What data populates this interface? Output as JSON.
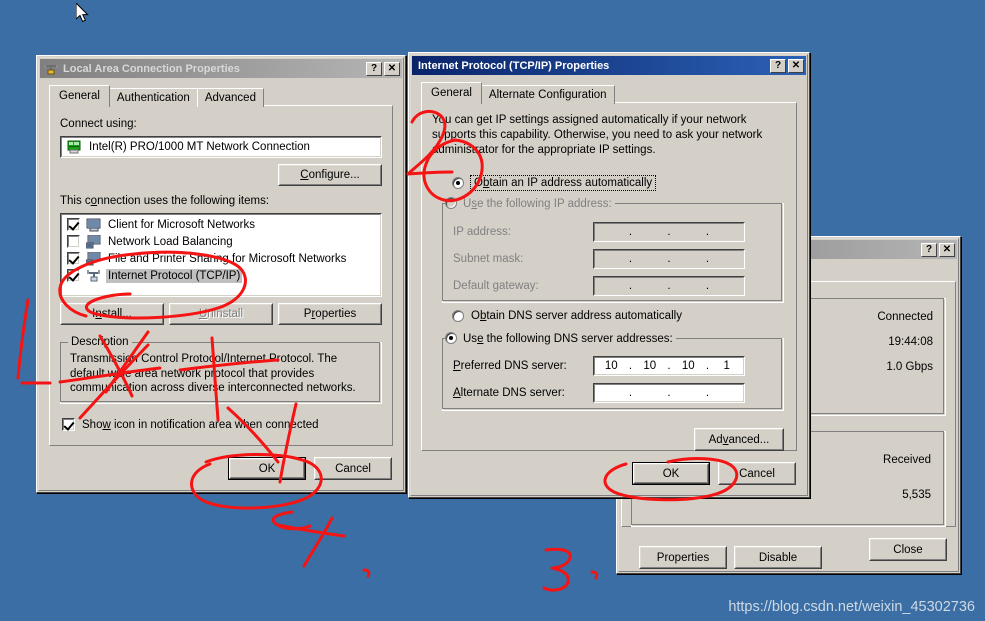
{
  "desktop": {
    "background_color": "#3a6ea5",
    "watermark": "https://blog.csdn.net/weixin_45302736",
    "cursor_icon": "mouse-pointer-icon"
  },
  "lac_dialog": {
    "title": "Local Area Connection Properties",
    "title_icon": "network-connection-icon",
    "help_button": "?",
    "close_button": "✕",
    "tabs": [
      {
        "label": "General",
        "selected": true
      },
      {
        "label": "Authentication",
        "selected": false
      },
      {
        "label": "Advanced",
        "selected": false
      }
    ],
    "connect_using_label": "Connect using:",
    "adapter_name": "Intel(R) PRO/1000 MT Network Connection",
    "adapter_icon": "network-adapter-icon",
    "configure_button": "Configure...",
    "items_label": "This connection uses the following items:",
    "items": [
      {
        "label": "Client for Microsoft Networks",
        "checked": true,
        "selected": false,
        "icon": "client-service-icon"
      },
      {
        "label": "Network Load Balancing",
        "checked": false,
        "selected": false,
        "icon": "service-icon"
      },
      {
        "label": "File and Printer Sharing for Microsoft Networks",
        "checked": true,
        "selected": false,
        "icon": "service-icon"
      },
      {
        "label": "Internet Protocol (TCP/IP)",
        "checked": true,
        "selected": true,
        "icon": "protocol-icon"
      }
    ],
    "install_button": "Install...",
    "uninstall_button": "Uninstall",
    "uninstall_disabled": true,
    "properties_button": "Properties",
    "description_group": "Description",
    "description_text": "Transmission Control Protocol/Internet Protocol. The default wide area network protocol that provides communication across diverse interconnected networks.",
    "show_icon_checkbox": {
      "label": "Show icon in notification area when connected",
      "checked": true
    },
    "ok_button": "OK",
    "cancel_button": "Cancel"
  },
  "tcpip_dialog": {
    "title": "Internet Protocol (TCP/IP) Properties",
    "help_button": "?",
    "close_button": "✕",
    "tabs": [
      {
        "label": "General",
        "selected": true
      },
      {
        "label": "Alternate Configuration",
        "selected": false
      }
    ],
    "intro_text": "You can get IP settings assigned automatically if your network supports this capability. Otherwise, you need to ask your network administrator for the appropriate IP settings.",
    "ip_auto_radio": {
      "label": "Obtain an IP address automatically",
      "selected": true,
      "focused": true
    },
    "ip_manual_radio": {
      "label": "Use the following IP address:",
      "selected": false,
      "disabled": true
    },
    "ip_address_label": "IP address:",
    "ip_address_value": [
      "",
      "",
      "",
      ""
    ],
    "subnet_mask_label": "Subnet mask:",
    "subnet_mask_value": [
      "",
      "",
      "",
      ""
    ],
    "default_gateway_label": "Default gateway:",
    "default_gateway_value": [
      "",
      "",
      "",
      ""
    ],
    "dns_auto_radio": {
      "label": "Obtain DNS server address automatically",
      "selected": false
    },
    "dns_manual_radio": {
      "label": "Use the following DNS server addresses:",
      "selected": true
    },
    "preferred_dns_label": "Preferred DNS server:",
    "preferred_dns_value": [
      "10",
      "10",
      "10",
      "1"
    ],
    "alternate_dns_label": "Alternate DNS server:",
    "alternate_dns_value": [
      "",
      "",
      "",
      ""
    ],
    "advanced_button": "Advanced...",
    "ok_button": "OK",
    "cancel_button": "Cancel"
  },
  "status_dialog": {
    "title": "",
    "help_button": "?",
    "close_button": "✕",
    "status_value": "Connected",
    "duration_value": "19:44:08",
    "speed_value": "1.0 Gbps",
    "activity_icon": "network-activity-icon",
    "received_label": "Received",
    "received_value": "5,535",
    "properties_button": "Properties",
    "disable_button": "Disable",
    "close_text_button": "Close"
  },
  "annotations": {
    "ink_color": "#f51414",
    "marks": [
      "circle-around-internet-protocol-item",
      "circle-around-obtain-ip-automatically",
      "scribble-over-description-box",
      "circle-around-lac-ok-button",
      "circle-around-tcpip-ok-button",
      "digit-1-left-margin",
      "digit-2-near-tcpip-intro",
      "digit-4-below-lac-ok",
      "digit-3-bottom-center"
    ]
  }
}
